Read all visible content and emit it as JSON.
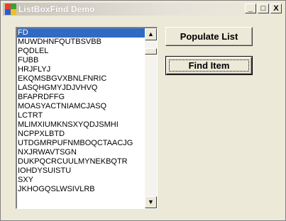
{
  "window": {
    "title": "ListBoxFind Demo",
    "minimize_label": "_",
    "restore_label": "□",
    "close_label": "X"
  },
  "listbox": {
    "items": [
      "FD",
      "MUWDHNFQUTBSVBB",
      "PQDLEL",
      "FUBB",
      "HRJFLYJ",
      "EKQMSBGVXBNLFNRIC",
      "LASQHGMYJDJVHVQ",
      "BFAPRDFFG",
      "MOASYACTNIAMCJASQ",
      "LCTRT",
      "MLIMXIUMKNSXYQDJSMHI",
      "NCPPXLBTD",
      "UTDGMRPUFNMBOQCTAACJG",
      "NXJRWAVTSGN",
      "DUKPQCRCUULMYNEKBQTR",
      "IOHDYSUISTU",
      "SXY",
      "JKHOGQSLWSIVLRB"
    ],
    "selected_index": 0
  },
  "buttons": {
    "populate_label": "Populate List",
    "find_label": "Find Item"
  },
  "colors": {
    "selection": "#316ac5",
    "window_bg": "#ece9d8"
  }
}
